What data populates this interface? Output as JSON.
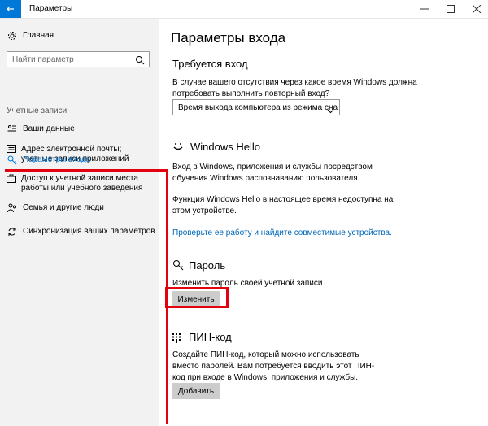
{
  "window": {
    "title": "Параметры"
  },
  "sidebar": {
    "home_label": "Главная",
    "search_placeholder": "Найти параметр",
    "section_title": "Учетные записи",
    "items": [
      {
        "label": "Ваши данные",
        "icon": "person-card-icon"
      },
      {
        "label": "Адрес электронной почты; учетные записи приложений",
        "icon": "mail-icon"
      },
      {
        "label": "Параметры входа",
        "icon": "key-icon",
        "active": true
      },
      {
        "label": "Доступ к учетной записи места работы или учебного заведения",
        "icon": "briefcase-icon"
      },
      {
        "label": "Семья и другие люди",
        "icon": "people-icon"
      },
      {
        "label": "Синхронизация ваших параметров",
        "icon": "sync-icon"
      }
    ]
  },
  "main": {
    "title": "Параметры входа",
    "signin_required": {
      "heading": "Требуется вход",
      "description": "В случае вашего отсутствия через какое время Windows должна потребовать выполнить повторный вход?",
      "dropdown_value": "Время выхода компьютера из режима сна"
    },
    "hello": {
      "heading": "Windows Hello",
      "description": "Вход в Windows, приложения и службы посредством обучения Windows распознаванию пользователя.",
      "status": "Функция Windows Hello в настоящее время недоступна на этом устройстве.",
      "link": "Проверьте ее работу и найдите совместимые устройства."
    },
    "password": {
      "heading": "Пароль",
      "description": "Изменить пароль своей учетной записи",
      "button": "Изменить"
    },
    "pin": {
      "heading": "ПИН-код",
      "description": "Создайте ПИН-код, который можно использовать вместо паролей. Вам потребуется вводить этот ПИН-код при входе в Windows, приложения и службы.",
      "button": "Добавить"
    }
  },
  "colors": {
    "accent": "#0078d7",
    "annotation": "#e3000f",
    "link": "#0067b8"
  }
}
